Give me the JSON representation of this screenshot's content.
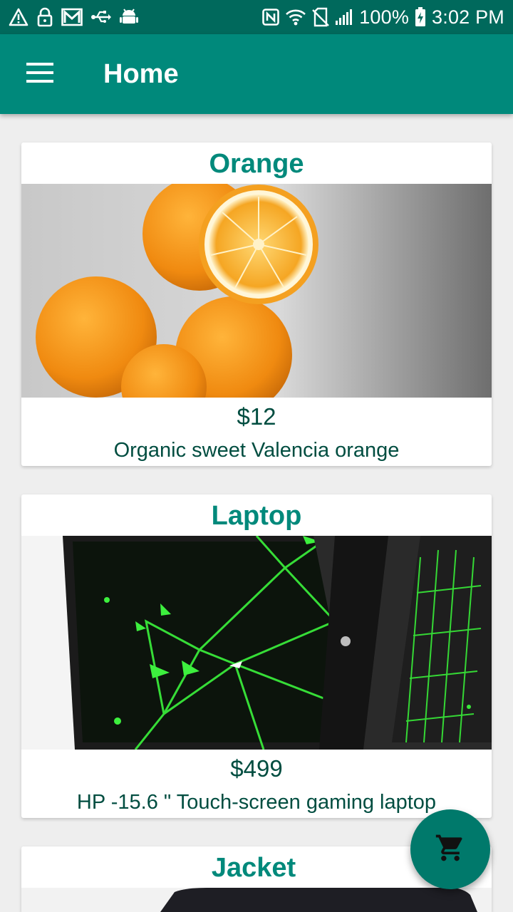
{
  "status_bar": {
    "battery": "100%",
    "time": "3:02 PM",
    "left_icons": [
      "warning-icon",
      "lock-icon",
      "gmail-icon",
      "usb-icon",
      "android-debug-icon"
    ],
    "right_icons": [
      "nfc-icon",
      "wifi-icon",
      "no-sim-icon",
      "signal-icon",
      "battery-charging-icon"
    ]
  },
  "app_bar": {
    "title": "Home",
    "menu_icon": "hamburger-menu-icon"
  },
  "products": [
    {
      "title": "Orange",
      "price": "$12",
      "description": "Organic sweet Valencia orange",
      "image": "orange-photo"
    },
    {
      "title": "Laptop",
      "price": "$499",
      "description": "HP -15.6 \" Touch-screen gaming laptop",
      "image": "laptop-photo"
    },
    {
      "title": "Jacket",
      "image": "jacket-photo"
    }
  ],
  "fab": {
    "icon": "shopping-cart-icon"
  },
  "colors": {
    "status_bar": "#00695c",
    "primary": "#00897b",
    "text_dark": "#004d40",
    "fab": "#00796b",
    "background": "#eeeeee"
  }
}
